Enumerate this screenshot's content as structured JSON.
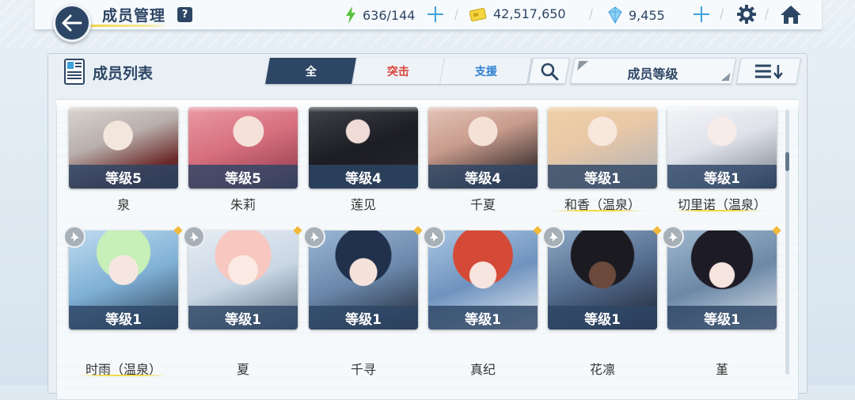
{
  "header": {
    "title": "成员管理",
    "help_label": "?",
    "ap": "636/144",
    "credits": "42,517,650",
    "gems": "9,455"
  },
  "panel": {
    "title": "成员列表",
    "tabs": [
      {
        "label": "全"
      },
      {
        "label": "突击"
      },
      {
        "label": "支援"
      }
    ],
    "sort_label": "成员等级"
  },
  "students_row1": [
    {
      "level": "等级5",
      "name": "泉"
    },
    {
      "level": "等级5",
      "name": "朱莉"
    },
    {
      "level": "等级4",
      "name": "莲见"
    },
    {
      "level": "等级4",
      "name": "千夏"
    },
    {
      "level": "等级1",
      "name": "和香（温泉）"
    },
    {
      "level": "等级1",
      "name": "切里诺（温泉）"
    }
  ],
  "students_row2": [
    {
      "level": "等级1",
      "name": "时雨（温泉）"
    },
    {
      "level": "等级1",
      "name": "夏"
    },
    {
      "level": "等级1",
      "name": "千寻"
    },
    {
      "level": "等级1",
      "name": "真纪"
    },
    {
      "level": "等级1",
      "name": "花凛"
    },
    {
      "level": "等级1",
      "name": "堇"
    }
  ],
  "colors": {
    "navy": "#2d4665",
    "accent_blue": "#3fa1e0",
    "striker_red": "#d9453b",
    "special_blue": "#2c7fd0",
    "highlight_yellow": "#f2d84b"
  },
  "icons": {
    "back": "arrow-left-icon",
    "ap": "lightning-icon",
    "credits": "credit-card-icon",
    "gems": "crystal-icon",
    "settings": "gear-icon",
    "home": "home-icon",
    "search": "search-icon",
    "sort_order": "sort-desc-icon",
    "pin": "pin-icon"
  }
}
